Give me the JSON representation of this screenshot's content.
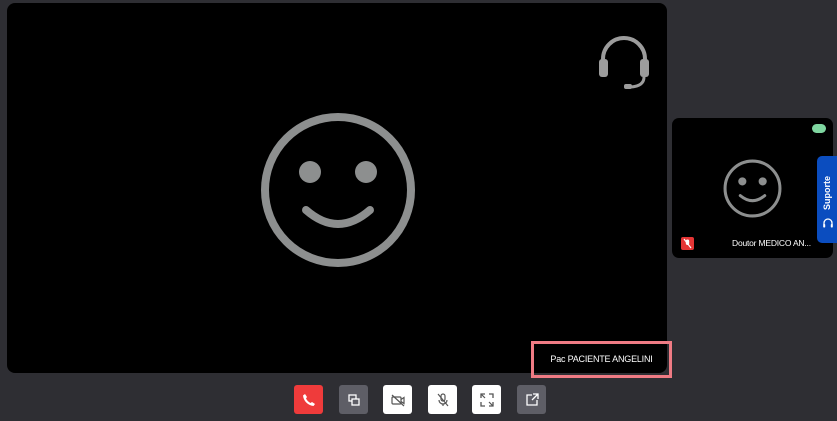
{
  "main_video": {
    "participant_name": "Pac PACIENTE ANGELINI",
    "avatar_icon": "smiley-face-icon",
    "audio_icon": "headset-icon"
  },
  "self_video": {
    "participant_name": "Doutor MEDICO AN...",
    "avatar_icon": "smiley-face-icon",
    "mic_status_icon": "mic-off-icon",
    "connection_icon": "signal-indicator-icon"
  },
  "support": {
    "label": "Suporte",
    "icon": "headset-icon"
  },
  "controls": [
    {
      "name": "hang-up-button",
      "icon": "phone-icon"
    },
    {
      "name": "switch-layout-button",
      "icon": "layout-switch-icon"
    },
    {
      "name": "camera-toggle-button",
      "icon": "video-off-icon"
    },
    {
      "name": "mic-toggle-button",
      "icon": "mic-off-icon"
    },
    {
      "name": "fullscreen-button",
      "icon": "expand-icon"
    },
    {
      "name": "share-button",
      "icon": "share-icon"
    }
  ],
  "colors": {
    "background": "#2e2e33",
    "video_bg": "#000000",
    "highlight": "#ef7b84",
    "hang_up": "#ef3b3b",
    "support": "#0b4dbf",
    "avatar": "#8d8f8f"
  }
}
